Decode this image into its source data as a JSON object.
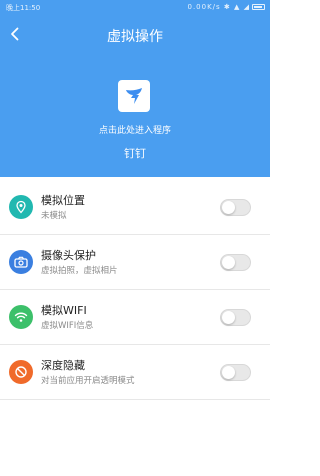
{
  "status_bar": {
    "time": "晚上11:50",
    "indicators": "0.00K/s ✱ ▲ ◢"
  },
  "nav": {
    "back_icon": "chevron-left-icon",
    "title": "虚拟操作"
  },
  "app": {
    "icon": "dingtalk-icon",
    "hint": "点击此处进入程序",
    "name": "钉钉"
  },
  "colors": {
    "header_bg": "#4a9ef0",
    "location": "#21b8b0",
    "camera": "#3a7fe0",
    "wifi": "#3cc06a",
    "hide": "#f06a2a"
  },
  "settings": [
    {
      "title": "模拟位置",
      "subtitle": "未模拟",
      "icon": "location-pin-icon",
      "enabled": false
    },
    {
      "title": "摄像头保护",
      "subtitle": "虚拟拍照，虚拟相片",
      "icon": "camera-icon",
      "enabled": false
    },
    {
      "title": "模拟WIFI",
      "subtitle": "虚拟WIFI信息",
      "icon": "wifi-icon",
      "enabled": false
    },
    {
      "title": "深度隐藏",
      "subtitle": "对当前应用开启透明模式",
      "icon": "block-icon",
      "enabled": false
    }
  ]
}
